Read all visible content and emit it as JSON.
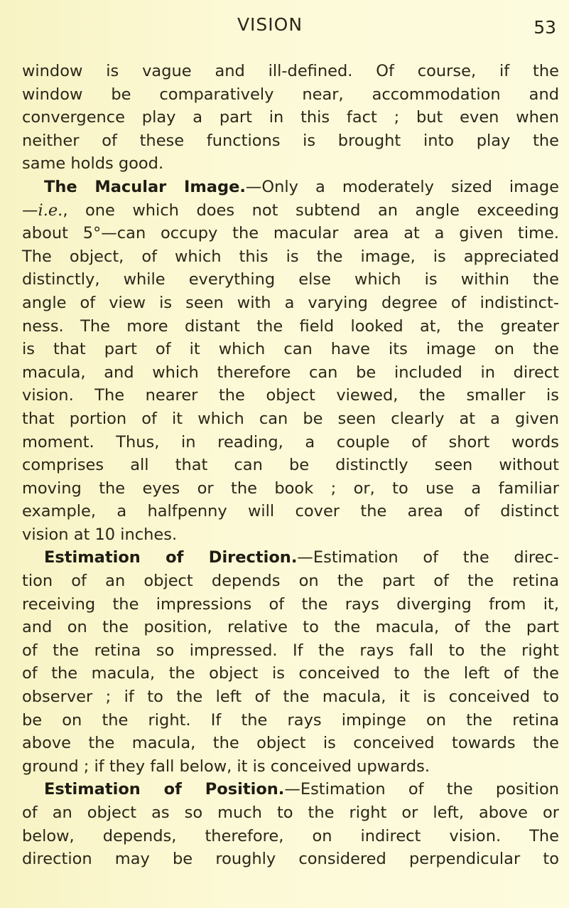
{
  "header": {
    "running_title": "VISION",
    "page_number": "53"
  },
  "lines": [
    {
      "text": "window is vague and ill-defined. Of course, if the"
    },
    {
      "text": "window be comparatively near, accommodation and"
    },
    {
      "text": "convergence play a part in this fact ; but even when"
    },
    {
      "text": "neither of these functions is brought into play the"
    },
    {
      "text": "same holds good.",
      "last": true
    },
    {
      "heading": "The Macular Image.",
      "text": "—Only a moderately sized image",
      "indent": true
    },
    {
      "pre": "—",
      "italic": "i.e.",
      "text": ", one which does not subtend an angle exceeding"
    },
    {
      "text": "about 5°—can occupy the macular area at a given time."
    },
    {
      "text": "The object, of which this is the image, is appreciated"
    },
    {
      "text": "distinctly, while everything else which is within the"
    },
    {
      "text": "angle of view is seen with a varying degree of indistinct-"
    },
    {
      "text": "ness. The more distant the field looked at, the greater"
    },
    {
      "text": "is that part of it which can have its image on the"
    },
    {
      "text": "macula, and which therefore can be included in direct"
    },
    {
      "text": "vision. The nearer the object viewed, the smaller is"
    },
    {
      "text": "that portion of it which can be seen clearly at a given"
    },
    {
      "text": "moment. Thus, in reading, a couple of short words"
    },
    {
      "text": "comprises all that can be distinctly seen without"
    },
    {
      "text": "moving the eyes or the book ; or, to use a familiar"
    },
    {
      "text": "example, a halfpenny will cover the area of distinct"
    },
    {
      "text": "vision at 10 inches.",
      "last": true
    },
    {
      "heading": "Estimation of Direction.",
      "text": "—Estimation of the direc-",
      "indent": true
    },
    {
      "text": "tion of an object depends on the part of the retina"
    },
    {
      "text": "receiving the impressions of the rays diverging from it,"
    },
    {
      "text": "and on the position, relative to the macula, of the part"
    },
    {
      "text": "of the retina so impressed. If the rays fall to the right"
    },
    {
      "text": "of the macula, the object is conceived to the left of the"
    },
    {
      "text": "observer ; if to the left of the macula, it is conceived to"
    },
    {
      "text": "be on the right. If the rays impinge on the retina"
    },
    {
      "text": "above the macula, the object is conceived towards the"
    },
    {
      "text": "ground ; if they fall below, it is conceived upwards.",
      "last": true
    },
    {
      "heading": "Estimation of Position.",
      "text": "—Estimation of the position",
      "indent": true
    },
    {
      "text": "of an object as so much to the right or left, above or"
    },
    {
      "text": "below, depends, therefore, on indirect vision. The"
    },
    {
      "text": "direction may be roughly considered perpendicular to"
    }
  ]
}
